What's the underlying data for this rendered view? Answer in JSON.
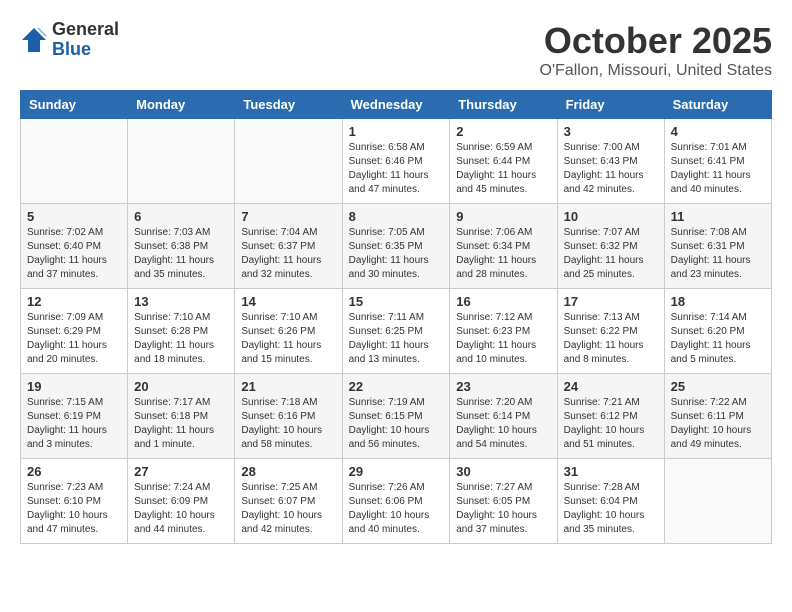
{
  "logo": {
    "general": "General",
    "blue": "Blue"
  },
  "header": {
    "month": "October 2025",
    "location": "O'Fallon, Missouri, United States"
  },
  "weekdays": [
    "Sunday",
    "Monday",
    "Tuesday",
    "Wednesday",
    "Thursday",
    "Friday",
    "Saturday"
  ],
  "weeks": [
    [
      {
        "day": "",
        "info": ""
      },
      {
        "day": "",
        "info": ""
      },
      {
        "day": "",
        "info": ""
      },
      {
        "day": "1",
        "info": "Sunrise: 6:58 AM\nSunset: 6:46 PM\nDaylight: 11 hours\nand 47 minutes."
      },
      {
        "day": "2",
        "info": "Sunrise: 6:59 AM\nSunset: 6:44 PM\nDaylight: 11 hours\nand 45 minutes."
      },
      {
        "day": "3",
        "info": "Sunrise: 7:00 AM\nSunset: 6:43 PM\nDaylight: 11 hours\nand 42 minutes."
      },
      {
        "day": "4",
        "info": "Sunrise: 7:01 AM\nSunset: 6:41 PM\nDaylight: 11 hours\nand 40 minutes."
      }
    ],
    [
      {
        "day": "5",
        "info": "Sunrise: 7:02 AM\nSunset: 6:40 PM\nDaylight: 11 hours\nand 37 minutes."
      },
      {
        "day": "6",
        "info": "Sunrise: 7:03 AM\nSunset: 6:38 PM\nDaylight: 11 hours\nand 35 minutes."
      },
      {
        "day": "7",
        "info": "Sunrise: 7:04 AM\nSunset: 6:37 PM\nDaylight: 11 hours\nand 32 minutes."
      },
      {
        "day": "8",
        "info": "Sunrise: 7:05 AM\nSunset: 6:35 PM\nDaylight: 11 hours\nand 30 minutes."
      },
      {
        "day": "9",
        "info": "Sunrise: 7:06 AM\nSunset: 6:34 PM\nDaylight: 11 hours\nand 28 minutes."
      },
      {
        "day": "10",
        "info": "Sunrise: 7:07 AM\nSunset: 6:32 PM\nDaylight: 11 hours\nand 25 minutes."
      },
      {
        "day": "11",
        "info": "Sunrise: 7:08 AM\nSunset: 6:31 PM\nDaylight: 11 hours\nand 23 minutes."
      }
    ],
    [
      {
        "day": "12",
        "info": "Sunrise: 7:09 AM\nSunset: 6:29 PM\nDaylight: 11 hours\nand 20 minutes."
      },
      {
        "day": "13",
        "info": "Sunrise: 7:10 AM\nSunset: 6:28 PM\nDaylight: 11 hours\nand 18 minutes."
      },
      {
        "day": "14",
        "info": "Sunrise: 7:10 AM\nSunset: 6:26 PM\nDaylight: 11 hours\nand 15 minutes."
      },
      {
        "day": "15",
        "info": "Sunrise: 7:11 AM\nSunset: 6:25 PM\nDaylight: 11 hours\nand 13 minutes."
      },
      {
        "day": "16",
        "info": "Sunrise: 7:12 AM\nSunset: 6:23 PM\nDaylight: 11 hours\nand 10 minutes."
      },
      {
        "day": "17",
        "info": "Sunrise: 7:13 AM\nSunset: 6:22 PM\nDaylight: 11 hours\nand 8 minutes."
      },
      {
        "day": "18",
        "info": "Sunrise: 7:14 AM\nSunset: 6:20 PM\nDaylight: 11 hours\nand 5 minutes."
      }
    ],
    [
      {
        "day": "19",
        "info": "Sunrise: 7:15 AM\nSunset: 6:19 PM\nDaylight: 11 hours\nand 3 minutes."
      },
      {
        "day": "20",
        "info": "Sunrise: 7:17 AM\nSunset: 6:18 PM\nDaylight: 11 hours\nand 1 minute."
      },
      {
        "day": "21",
        "info": "Sunrise: 7:18 AM\nSunset: 6:16 PM\nDaylight: 10 hours\nand 58 minutes."
      },
      {
        "day": "22",
        "info": "Sunrise: 7:19 AM\nSunset: 6:15 PM\nDaylight: 10 hours\nand 56 minutes."
      },
      {
        "day": "23",
        "info": "Sunrise: 7:20 AM\nSunset: 6:14 PM\nDaylight: 10 hours\nand 54 minutes."
      },
      {
        "day": "24",
        "info": "Sunrise: 7:21 AM\nSunset: 6:12 PM\nDaylight: 10 hours\nand 51 minutes."
      },
      {
        "day": "25",
        "info": "Sunrise: 7:22 AM\nSunset: 6:11 PM\nDaylight: 10 hours\nand 49 minutes."
      }
    ],
    [
      {
        "day": "26",
        "info": "Sunrise: 7:23 AM\nSunset: 6:10 PM\nDaylight: 10 hours\nand 47 minutes."
      },
      {
        "day": "27",
        "info": "Sunrise: 7:24 AM\nSunset: 6:09 PM\nDaylight: 10 hours\nand 44 minutes."
      },
      {
        "day": "28",
        "info": "Sunrise: 7:25 AM\nSunset: 6:07 PM\nDaylight: 10 hours\nand 42 minutes."
      },
      {
        "day": "29",
        "info": "Sunrise: 7:26 AM\nSunset: 6:06 PM\nDaylight: 10 hours\nand 40 minutes."
      },
      {
        "day": "30",
        "info": "Sunrise: 7:27 AM\nSunset: 6:05 PM\nDaylight: 10 hours\nand 37 minutes."
      },
      {
        "day": "31",
        "info": "Sunrise: 7:28 AM\nSunset: 6:04 PM\nDaylight: 10 hours\nand 35 minutes."
      },
      {
        "day": "",
        "info": ""
      }
    ]
  ]
}
